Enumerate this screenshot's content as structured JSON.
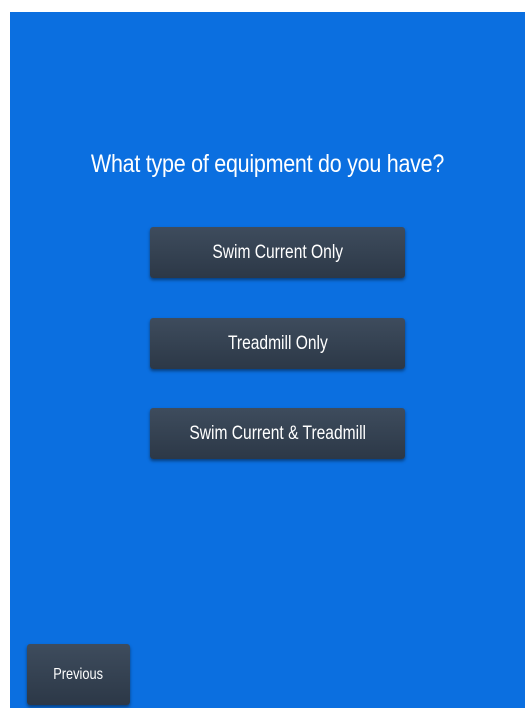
{
  "colors": {
    "background": "#0b6fe0",
    "button": "#34414f",
    "text": "#ffffff"
  },
  "question": "What type of equipment do you have?",
  "options": [
    {
      "label": "Swim Current Only"
    },
    {
      "label": "Treadmill Only"
    },
    {
      "label": "Swim Current & Treadmill"
    }
  ],
  "navigation": {
    "previous_label": "Previous"
  }
}
